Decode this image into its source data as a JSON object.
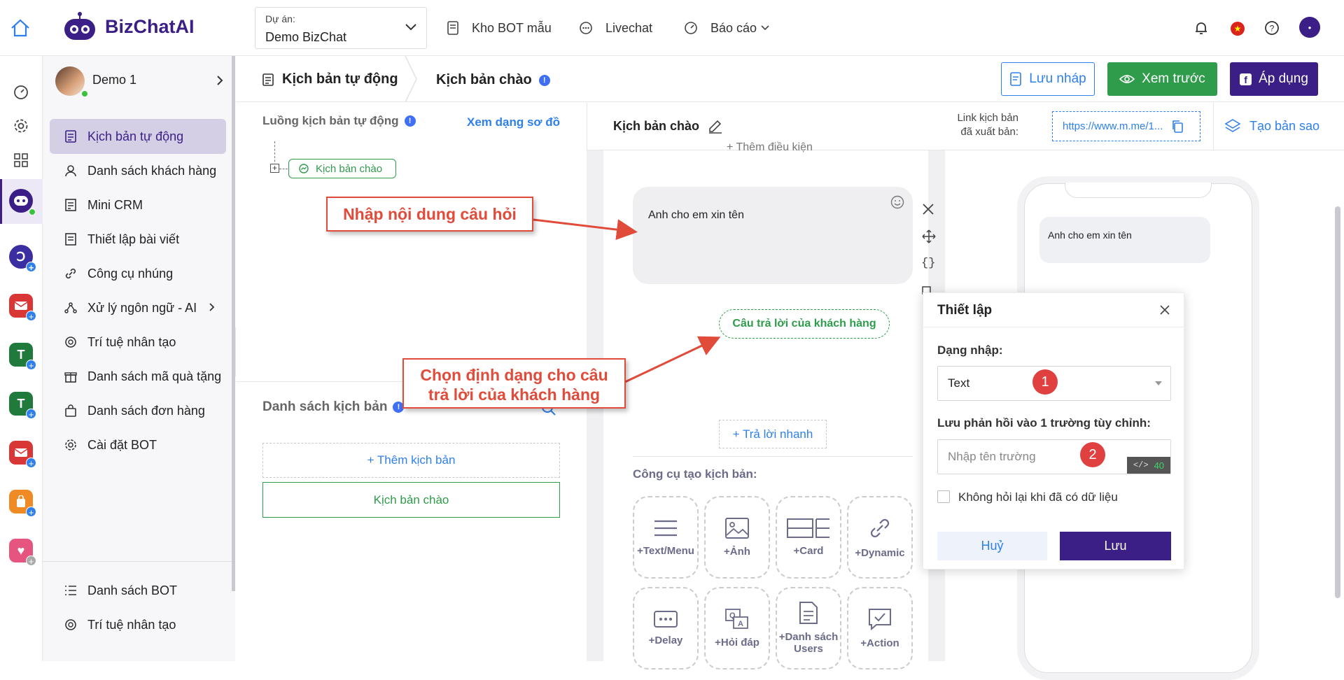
{
  "brand": {
    "name": "BizChatAI"
  },
  "project": {
    "label": "Dự án:",
    "value": "Demo BizChat"
  },
  "topnav": {
    "templates": "Kho BOT mẫu",
    "livechat": "Livechat",
    "reports": "Báo cáo"
  },
  "user": {
    "name": "Demo 1"
  },
  "sidebar": {
    "items": [
      {
        "label": "Kịch bản tự động",
        "icon": "script-icon"
      },
      {
        "label": "Danh sách khách hàng",
        "icon": "user-icon"
      },
      {
        "label": "Mini CRM",
        "icon": "crm-icon"
      },
      {
        "label": "Thiết lập bài viết",
        "icon": "post-icon"
      },
      {
        "label": "Công cụ nhúng",
        "icon": "link-icon"
      },
      {
        "label": "Xử lý ngôn ngữ - AI",
        "icon": "nlp-icon"
      },
      {
        "label": "Trí tuệ nhân tạo",
        "icon": "ai-icon"
      },
      {
        "label": "Danh sách mã quà tặng",
        "icon": "gift-icon"
      },
      {
        "label": "Danh sách đơn hàng",
        "icon": "bag-icon"
      },
      {
        "label": "Cài đặt BOT",
        "icon": "gear-icon"
      }
    ],
    "bottom": [
      {
        "label": "Danh sách BOT",
        "icon": "list-icon"
      },
      {
        "label": "Trí tuệ nhân tạo",
        "icon": "ai-icon"
      }
    ]
  },
  "breadcrumb": {
    "root": "Kịch bản tự động",
    "current": "Kịch bản chào"
  },
  "actions": {
    "draft": "Lưu nháp",
    "preview": "Xem trước",
    "apply": "Áp dụng"
  },
  "flow": {
    "title": "Luồng kịch bản tự động",
    "view_diagram": "Xem dạng sơ đồ",
    "node": "Kịch bản chào"
  },
  "script_list": {
    "title": "Danh sách kịch bản",
    "add": "+ Thêm kịch bản",
    "item": "Kịch bản chào"
  },
  "editor": {
    "title": "Kịch bản chào",
    "link_label_1": "Link kịch bản",
    "link_label_2": "đã xuất bản:",
    "link_value": "https://www.m.me/1...",
    "copy_scenario": "Tạo bản sao",
    "add_condition": "+ Thêm điều kiện",
    "message": "Anh cho em xin tên",
    "customer_reply": "Câu trả lời của khách hàng",
    "quick_reply": "+ Trả lời nhanh",
    "tools_title": "Công cụ tạo kịch bản:",
    "tools": [
      {
        "label": "+Text/Menu",
        "icon": "menu-lines-icon"
      },
      {
        "label": "+Ảnh",
        "icon": "image-icon"
      },
      {
        "label": "+Card",
        "icon": "card-icon"
      },
      {
        "label": "+Dynamic",
        "icon": "dynamic-link-icon"
      },
      {
        "label": "+Delay",
        "icon": "delay-icon"
      },
      {
        "label": "+Hỏi đáp",
        "icon": "qa-icon"
      },
      {
        "label": "+Danh sách Users",
        "icon": "user-list-icon"
      },
      {
        "label": "+Action",
        "icon": "action-icon"
      }
    ]
  },
  "phone": {
    "message": "Anh cho em xin tên"
  },
  "settings": {
    "title": "Thiết lập",
    "input_type_label": "Dạng nhập:",
    "input_type_value": "Text",
    "save_field_label": "Lưu phản hồi vào 1 trường tùy chỉnh:",
    "field_placeholder": "Nhập tên trường",
    "char_count": "40",
    "no_reask": "Không hỏi lại khi đã có dữ liệu",
    "cancel": "Huỷ",
    "save": "Lưu"
  },
  "callouts": {
    "enter_question": "Nhập nội dung câu hỏi",
    "choose_format_1": "Chọn định dạng cho câu",
    "choose_format_2": "trả lời của khách hàng",
    "step1": "1",
    "step2": "2"
  },
  "colors": {
    "brand": "#3b1e86",
    "green": "#2e9c4a",
    "blue": "#2f80ed",
    "annotation": "#e04b3a"
  }
}
